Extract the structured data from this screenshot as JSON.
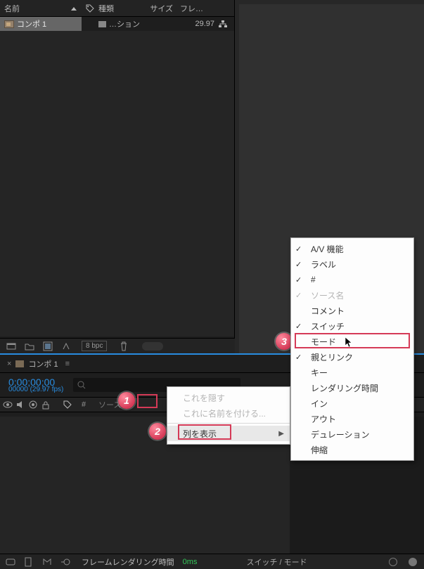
{
  "project": {
    "headers": {
      "name": "名前",
      "type": "種類",
      "size": "サイズ",
      "fps": "フレ…"
    },
    "row": {
      "name": "コンポ 1",
      "type": "…ション",
      "fps": "29.97"
    },
    "toolbar": {
      "bpc": "8 bpc"
    }
  },
  "timeline": {
    "tab_name": "コンポ 1",
    "timecode": "0;00;00;00",
    "frames_fps": "00000 (29.97 fps)",
    "search_placeholder": "",
    "col_hash": "#",
    "col_source": "ソース…",
    "footer": {
      "render_label": "フレームレンダリング時間",
      "render_time": "0ms",
      "switch_mode": "スイッチ / モード"
    }
  },
  "context_menu_1": {
    "hide": "これを隠す",
    "rename": "これに名前を付ける...",
    "show_columns": "列を表示"
  },
  "columns_menu": {
    "av": "A/V 機能",
    "label": "ラベル",
    "hash": "#",
    "source": "ソース名",
    "comment": "コメント",
    "switch": "スイッチ",
    "mode": "モード",
    "parent": "親とリンク",
    "key": "キー",
    "rendertime": "レンダリング時間",
    "in": "イン",
    "out": "アウト",
    "duration": "デュレーション",
    "stretch": "伸縮"
  },
  "annotations": {
    "b1": "1",
    "b2": "2",
    "b3": "3"
  }
}
